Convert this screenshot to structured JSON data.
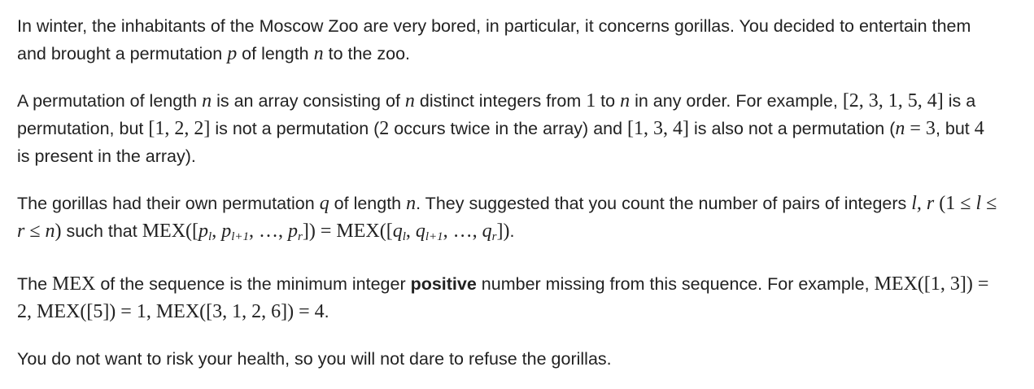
{
  "p1": {
    "t1": "In winter, the inhabitants of the Moscow Zoo are very bored, in particular, it concerns gorillas. You decided to entertain them and brought a permutation ",
    "v1": "p",
    "t2": " of length ",
    "v2": "n",
    "t3": " to the zoo."
  },
  "p2": {
    "t1": "A permutation of length ",
    "v1": "n",
    "t2": " is an array consisting of ",
    "v2": "n",
    "t3": " distinct integers from ",
    "m1": "1",
    "t4": " to ",
    "v3": "n",
    "t5": " in any order. For example, ",
    "m2": "[2, 3, 1, 5, 4]",
    "t6": " is a permutation, but ",
    "m3": "[1, 2, 2]",
    "t7": " is not a permutation (",
    "m4": "2",
    "t8": " occurs twice in the array) and ",
    "m5": "[1, 3, 4]",
    "t9": " is also not a permutation (",
    "v4": "n",
    "m6": " = 3",
    "t10": ", but ",
    "m7": "4",
    "t11": " is present in the array)."
  },
  "p3": {
    "t1": "The gorillas had their own permutation ",
    "v1": "q",
    "t2": " of length ",
    "v2": "n",
    "t3": ". They suggested that you count the number of pairs of integers ",
    "v3": "l, r",
    "m1": " (1 ≤ ",
    "v4": "l",
    "m2": " ≤ ",
    "v5": "r",
    "m3": " ≤ ",
    "v6": "n",
    "m4": ")",
    "t4": " such that ",
    "m5": "MEX([",
    "v7": "p",
    "s1": "l",
    "m6": ", ",
    "v8": "p",
    "s2": "l+1",
    "m7": ", …, ",
    "v9": "p",
    "s3": "r",
    "m8": "]) = MEX([",
    "v10": "q",
    "s4": "l",
    "m9": ", ",
    "v11": "q",
    "s5": "l+1",
    "m10": ", …, ",
    "v12": "q",
    "s6": "r",
    "m11": "])",
    "t5": "."
  },
  "p4": {
    "t1": "The ",
    "m1": "MEX",
    "t2": " of the sequence is the minimum integer ",
    "b1": "positive",
    "t3": " number missing from this sequence. For example, ",
    "m2": "MEX([1, 3]) = 2, MEX([5]) = 1, MEX([3, 1, 2, 6]) = 4",
    "t4": "."
  },
  "p5": {
    "t1": "You do not want to risk your health, so you will not dare to refuse the gorillas."
  }
}
